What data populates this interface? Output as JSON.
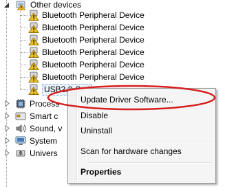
{
  "tree": {
    "category_other_devices": "Other devices",
    "devices": [
      "Bluetooth Peripheral Device",
      "Bluetooth Peripheral Device",
      "Bluetooth Peripheral Device",
      "Bluetooth Peripheral Device",
      "Bluetooth Peripheral Device",
      "Bluetooth Peripheral Device"
    ],
    "selected_device_truncated": "USB2.0-Seri",
    "categories_below": [
      "Process",
      "Smart c",
      "Sound, v",
      "System",
      "Univers"
    ]
  },
  "context_menu": {
    "items": [
      "Update Driver Software...",
      "Disable",
      "Uninstall",
      "Scan for hardware changes",
      "Properties"
    ]
  },
  "colors": {
    "annotation_ellipse": "#d62020",
    "warning_triangle": "#f0c020",
    "menu_background": "#f5f5f5",
    "menu_border": "#979797"
  }
}
